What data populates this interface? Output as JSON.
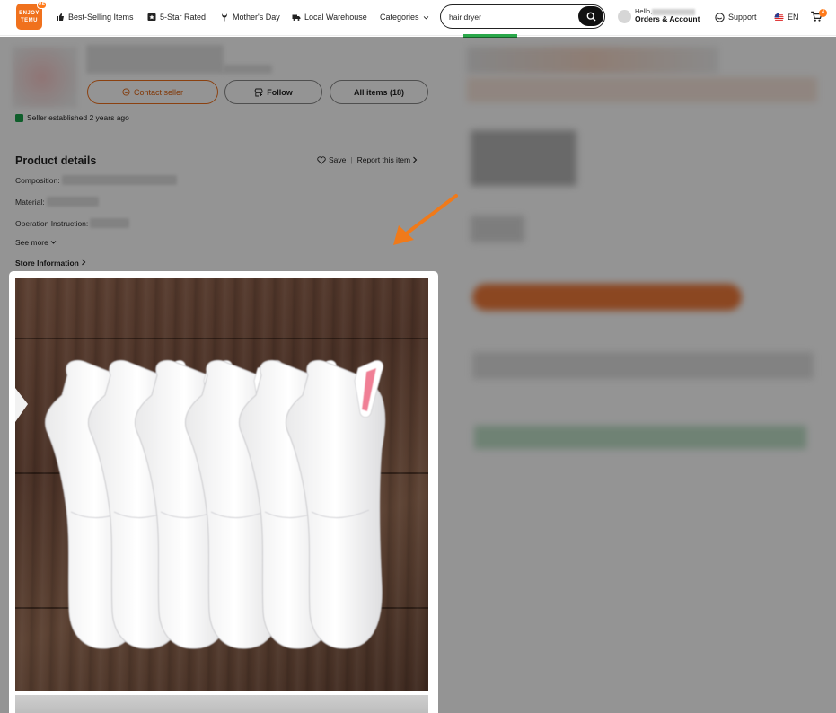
{
  "header": {
    "logo_text": "ENJOY TEMU",
    "logo_badge": "US",
    "nav": [
      {
        "label": "Best-Selling Items",
        "icon": "thumbs-up-icon"
      },
      {
        "label": "5-Star Rated",
        "icon": "star-badge-icon"
      },
      {
        "label": "Mother's Day",
        "icon": "tulip-icon"
      },
      {
        "label": "Local Warehouse",
        "icon": "truck-icon"
      },
      {
        "label": "Categories",
        "icon": "chevron-down-icon"
      }
    ],
    "search": {
      "value": "hair dryer"
    },
    "account": {
      "greeting": "Hello,",
      "label": "Orders & Account"
    },
    "support_label": "Support",
    "language": "EN",
    "cart_count": "4"
  },
  "seller": {
    "contact_label": "Contact seller",
    "follow_label": "Follow",
    "all_items_label": "All items (18)",
    "established": "Seller established 2 years ago"
  },
  "product_details": {
    "title": "Product details",
    "save_label": "Save",
    "report_label": "Report this item",
    "attributes": [
      {
        "label": "Composition:"
      },
      {
        "label": "Material:"
      },
      {
        "label": "Operation Instruction:"
      }
    ],
    "see_more": "See more",
    "store_info": "Store Information"
  },
  "colors": {
    "accent": "#f0711d",
    "overlay": "rgba(0,0,0,0.42)",
    "sock_stripes": [
      "#444444",
      "#9b6fd4",
      "#f0c020",
      "#7fd3c2",
      "#f07f95"
    ]
  }
}
